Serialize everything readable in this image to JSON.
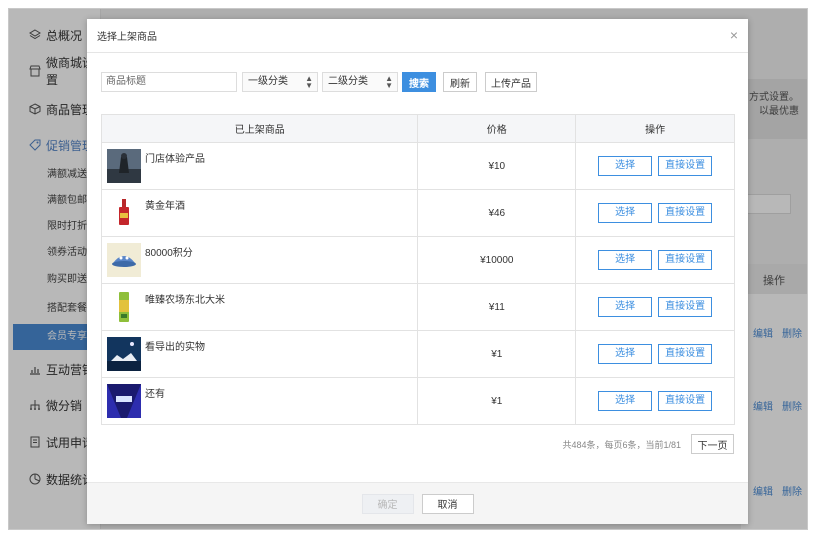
{
  "sidebar": {
    "items": [
      {
        "label": "总概况",
        "icon": "layers-icon"
      },
      {
        "label": "微商城设置",
        "icon": "store-icon"
      },
      {
        "label": "商品管理",
        "icon": "box-icon"
      },
      {
        "label": "促销管理",
        "icon": "tag-icon"
      }
    ],
    "subitems": [
      "满额减送",
      "满额包邮",
      "限时打折",
      "领券活动",
      "购买即送",
      "搭配套餐",
      "会员专享价"
    ],
    "active_sub": 6,
    "items2": [
      {
        "label": "互动营销",
        "icon": "chart-icon"
      },
      {
        "label": "微分销",
        "icon": "network-icon"
      },
      {
        "label": "试用申请",
        "icon": "form-icon"
      },
      {
        "label": "数据统计",
        "icon": "pie-icon"
      }
    ]
  },
  "background": {
    "notice_line1": "方式设置。",
    "notice_line2": "以最优惠",
    "ops_header": "操作",
    "edit_label": "编辑",
    "delete_label": "删除"
  },
  "modal": {
    "title": "选择上架商品",
    "close": "×",
    "search_placeholder": "商品标题",
    "category1": "一级分类",
    "category2": "二级分类",
    "search_btn": "搜索",
    "refresh_btn": "刷新",
    "upload_btn": "上传产品",
    "columns": [
      "已上架商品",
      "价格",
      "操作"
    ],
    "rows": [
      {
        "name": "门店体验产品",
        "price": "¥10",
        "thumb": "photo-dark-icon"
      },
      {
        "name": "黄金年酒",
        "price": "¥46",
        "thumb": "wine-bottle-icon"
      },
      {
        "name": "80000积分",
        "price": "¥10000",
        "thumb": "cartoon-icon"
      },
      {
        "name": "唯臻农场东北大米",
        "price": "¥11",
        "thumb": "rice-bag-icon"
      },
      {
        "name": "看导出的实物",
        "price": "¥1",
        "thumb": "night-scene-icon"
      },
      {
        "name": "还有",
        "price": "¥1",
        "thumb": "stage-icon"
      }
    ],
    "select_label": "选择",
    "direct_label": "直接设置",
    "pager_info": "共484条，每页6条，当前1/81",
    "next_btn": "下一页",
    "confirm_btn": "确定",
    "cancel_btn": "取消"
  },
  "colors": {
    "accent": "#3d8fe0",
    "active_nav": "#4a8bd5"
  }
}
